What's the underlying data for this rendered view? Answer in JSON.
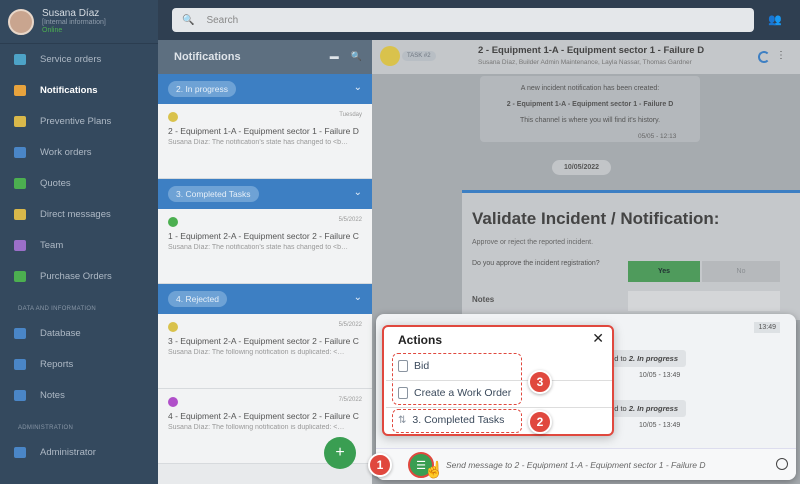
{
  "profile": {
    "name": "Susana Díaz",
    "sub": "[Internal information]",
    "status": "Online"
  },
  "sidebar": {
    "items": [
      {
        "label": "Service orders",
        "color": "#4da3c7"
      },
      {
        "label": "Notifications",
        "color": "#e8a33d"
      },
      {
        "label": "Preventive Plans",
        "color": "#d9b84a"
      },
      {
        "label": "Work orders",
        "color": "#4a86c7"
      },
      {
        "label": "Quotes",
        "color": "#4caf50"
      },
      {
        "label": "Direct messages",
        "color": "#d9b84a"
      },
      {
        "label": "Team",
        "color": "#9b6fc9"
      },
      {
        "label": "Purchase Orders",
        "color": "#4caf50"
      }
    ],
    "section_data": "DATA AND INFORMATION",
    "data_items": [
      {
        "label": "Database",
        "color": "#4a86c7"
      },
      {
        "label": "Reports",
        "color": "#4a86c7"
      },
      {
        "label": "Notes",
        "color": "#4a86c7"
      }
    ],
    "section_admin": "ADMINISTRATION",
    "admin_items": [
      {
        "label": "Administrator",
        "color": "#4a86c7"
      }
    ]
  },
  "search": {
    "placeholder": "Search"
  },
  "notifications": {
    "title": "Notifications",
    "groups": [
      {
        "label": "2. In progress",
        "cards": [
          {
            "date": "Tuesday",
            "title": "2 - Equipment 1-A - Equipment sector 1 - Failure D",
            "body": "Susana Díaz: The notification's state has changed to <b…",
            "dot": "#d9c24c"
          }
        ]
      },
      {
        "label": "3. Completed Tasks",
        "cards": [
          {
            "date": "5/5/2022",
            "title": "1 - Equipment 2-A - Equipment sector 2 - Failure C",
            "body": "Susana Díaz: The notification's state has changed to <b…",
            "dot": "#4caf50"
          }
        ]
      },
      {
        "label": "4. Rejected",
        "cards": [
          {
            "date": "5/5/2022",
            "title": "3 - Equipment 2-A - Equipment sector 2 - Failure C",
            "body": "Susana Díaz: The following notification is duplicated: <…",
            "dot": "#d9c24c"
          },
          {
            "date": "7/5/2022",
            "title": "4 - Equipment 2-A - Equipment sector 2 - Failure C",
            "body": "Susana Díaz: The following notification is duplicated: <…",
            "dot": "#b04fc9"
          }
        ]
      }
    ]
  },
  "chat": {
    "badge": "TASK #2",
    "title": "2 - Equipment 1-A - Equipment sector 1 - Failure D",
    "members": "Susana Díaz, Builder Admin Maintenance, Layla Nassar, Thomas Gardner",
    "system_msg": {
      "line1": "A new incident notification has been created:",
      "line2": "2 - Equipment 1-A - Equipment sector 1 - Failure D",
      "line3": "This channel is where you will find it's history."
    },
    "system_time": "05/05 - 12:13",
    "date_pill": "10/05/2022",
    "validate": {
      "heading": "Validate Incident / Notification:",
      "p1": "Approve or reject the reported incident.",
      "p2": "Do you approve the incident registration?",
      "yes": "Yes",
      "no": "No",
      "notes": "Notes"
    },
    "box_time": "13:49",
    "messages": [
      {
        "prefix": "d to ",
        "state": "2. In progress",
        "time": "10/05 - 13:49"
      },
      {
        "prefix": "d to ",
        "state": "2. In progress",
        "time": "10/05 - 13:49"
      }
    ],
    "input_placeholder": "Send message to 2 - Equipment 1-A - Equipment sector 1 - Failure D"
  },
  "actions": {
    "title": "Actions",
    "items": [
      "Bid",
      "Create a Work Order",
      "3. Completed Tasks"
    ]
  },
  "callouts": [
    "1",
    "2",
    "3"
  ],
  "fab": {
    "symbol": "+"
  }
}
